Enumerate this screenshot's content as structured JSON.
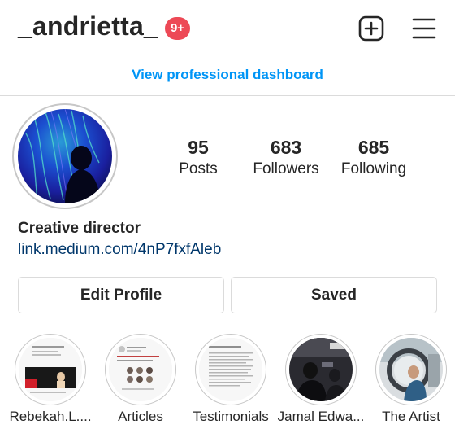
{
  "header": {
    "username": "_andrietta_",
    "notification_badge": "9+",
    "badge_color": "#ed4956",
    "new_post_icon": "plus-square-icon",
    "menu_icon": "hamburger-menu-icon"
  },
  "dashboard": {
    "label": "View professional dashboard",
    "color": "#0095f6"
  },
  "profile": {
    "stats": [
      {
        "value": "95",
        "label": "Posts"
      },
      {
        "value": "683",
        "label": "Followers"
      },
      {
        "value": "685",
        "label": "Following"
      }
    ],
    "bio_name": "Creative director",
    "bio_link": "link.medium.com/4nP7fxfAleb"
  },
  "actions": {
    "edit_profile": "Edit Profile",
    "saved": "Saved"
  },
  "highlights": [
    {
      "label": "Rebekah.L...."
    },
    {
      "label": "Articles"
    },
    {
      "label": "Testimonials"
    },
    {
      "label": "Jamal Edwa..."
    },
    {
      "label": "The Artist"
    }
  ]
}
